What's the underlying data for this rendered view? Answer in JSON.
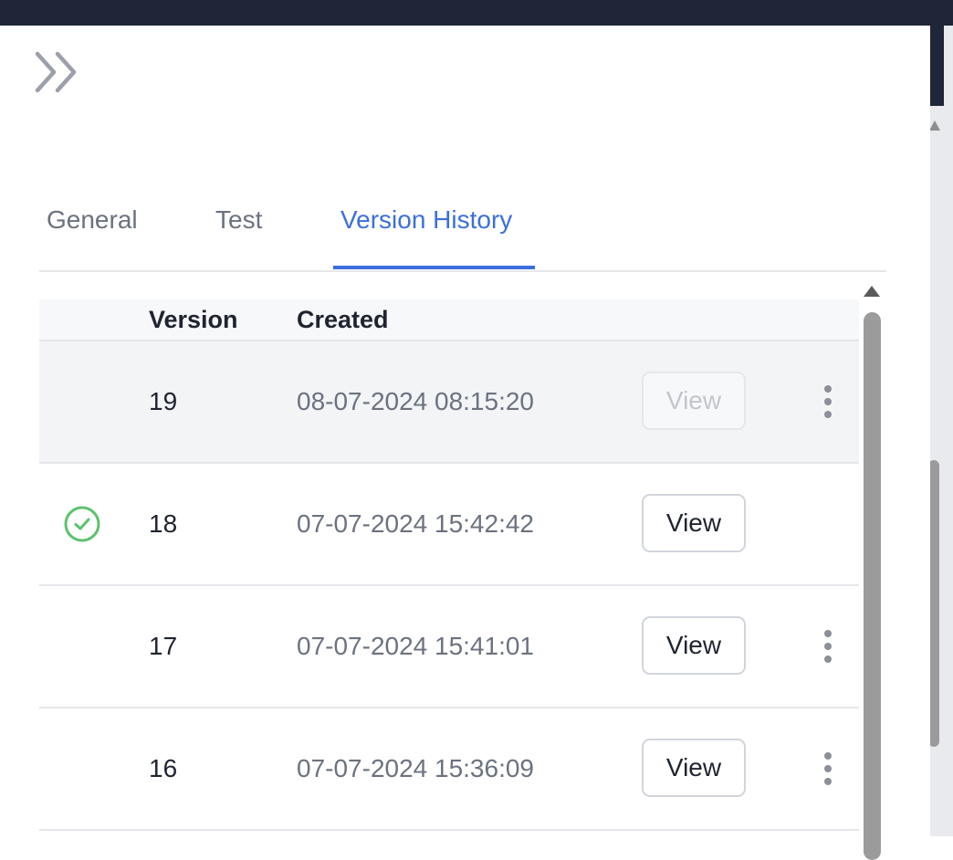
{
  "tabs": [
    {
      "label": "General"
    },
    {
      "label": "Test"
    },
    {
      "label": "Version History"
    }
  ],
  "table": {
    "headers": {
      "version": "Version",
      "created": "Created"
    },
    "rows": [
      {
        "version": "19",
        "created": "08-07-2024 08:15:20",
        "view": "View",
        "view_enabled": false,
        "current": false,
        "menu": true
      },
      {
        "version": "18",
        "created": "07-07-2024 15:42:42",
        "view": "View",
        "view_enabled": true,
        "current": true,
        "menu": false
      },
      {
        "version": "17",
        "created": "07-07-2024 15:41:01",
        "view": "View",
        "view_enabled": true,
        "current": false,
        "menu": true
      },
      {
        "version": "16",
        "created": "07-07-2024 15:36:09",
        "view": "View",
        "view_enabled": true,
        "current": false,
        "menu": true
      }
    ]
  },
  "colors": {
    "accent": "#3b6fdd",
    "topbar": "#1f2637",
    "current_check": "#5cc26d"
  },
  "icons": {
    "collapse": "chevrons-right-icon",
    "current": "check-circle-icon",
    "menu": "more-vertical-icon"
  }
}
